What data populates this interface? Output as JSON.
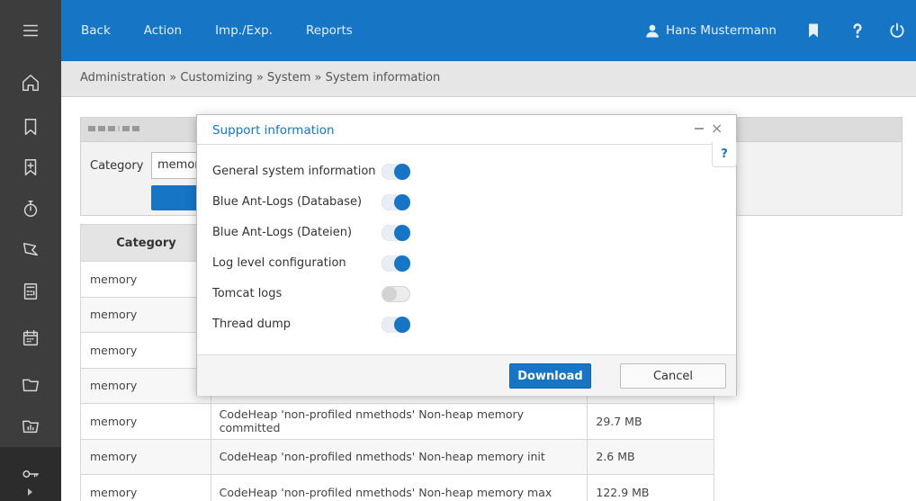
{
  "topbar": {
    "nav": [
      "Back",
      "Action",
      "Imp./Exp.",
      "Reports"
    ],
    "user_name": "Hans Mustermann"
  },
  "breadcrumb": "Administration  »  Customizing  »  System  »  System information",
  "filter": {
    "category_label": "Category",
    "category_value": "memor"
  },
  "table": {
    "header_category": "Category",
    "rows": [
      {
        "category": "memory",
        "name": "",
        "value": ""
      },
      {
        "category": "memory",
        "name": "",
        "value": ""
      },
      {
        "category": "memory",
        "name": "",
        "value": ""
      },
      {
        "category": "memory",
        "name": "",
        "value": ""
      },
      {
        "category": "memory",
        "name": "CodeHeap 'non-profiled nmethods' Non-heap memory committed",
        "value": "29.7 MB"
      },
      {
        "category": "memory",
        "name": "CodeHeap 'non-profiled nmethods' Non-heap memory init",
        "value": "2.6 MB"
      },
      {
        "category": "memory",
        "name": "CodeHeap 'non-profiled nmethods' Non-heap memory max",
        "value": "122.9 MB"
      }
    ]
  },
  "modal": {
    "title": "Support information",
    "close_glyph": "×",
    "help_glyph": "?",
    "options": [
      {
        "label": "General system information",
        "on": true
      },
      {
        "label": "Blue Ant-Logs (Database)",
        "on": true
      },
      {
        "label": "Blue Ant-Logs (Dateien)",
        "on": true
      },
      {
        "label": "Log level configuration",
        "on": true
      },
      {
        "label": "Tomcat logs",
        "on": false
      },
      {
        "label": "Thread dump",
        "on": true
      }
    ],
    "download_label": "Download",
    "cancel_label": "Cancel"
  },
  "colors": {
    "primary": "#1675c5",
    "sidebar": "#3d3d3d"
  }
}
